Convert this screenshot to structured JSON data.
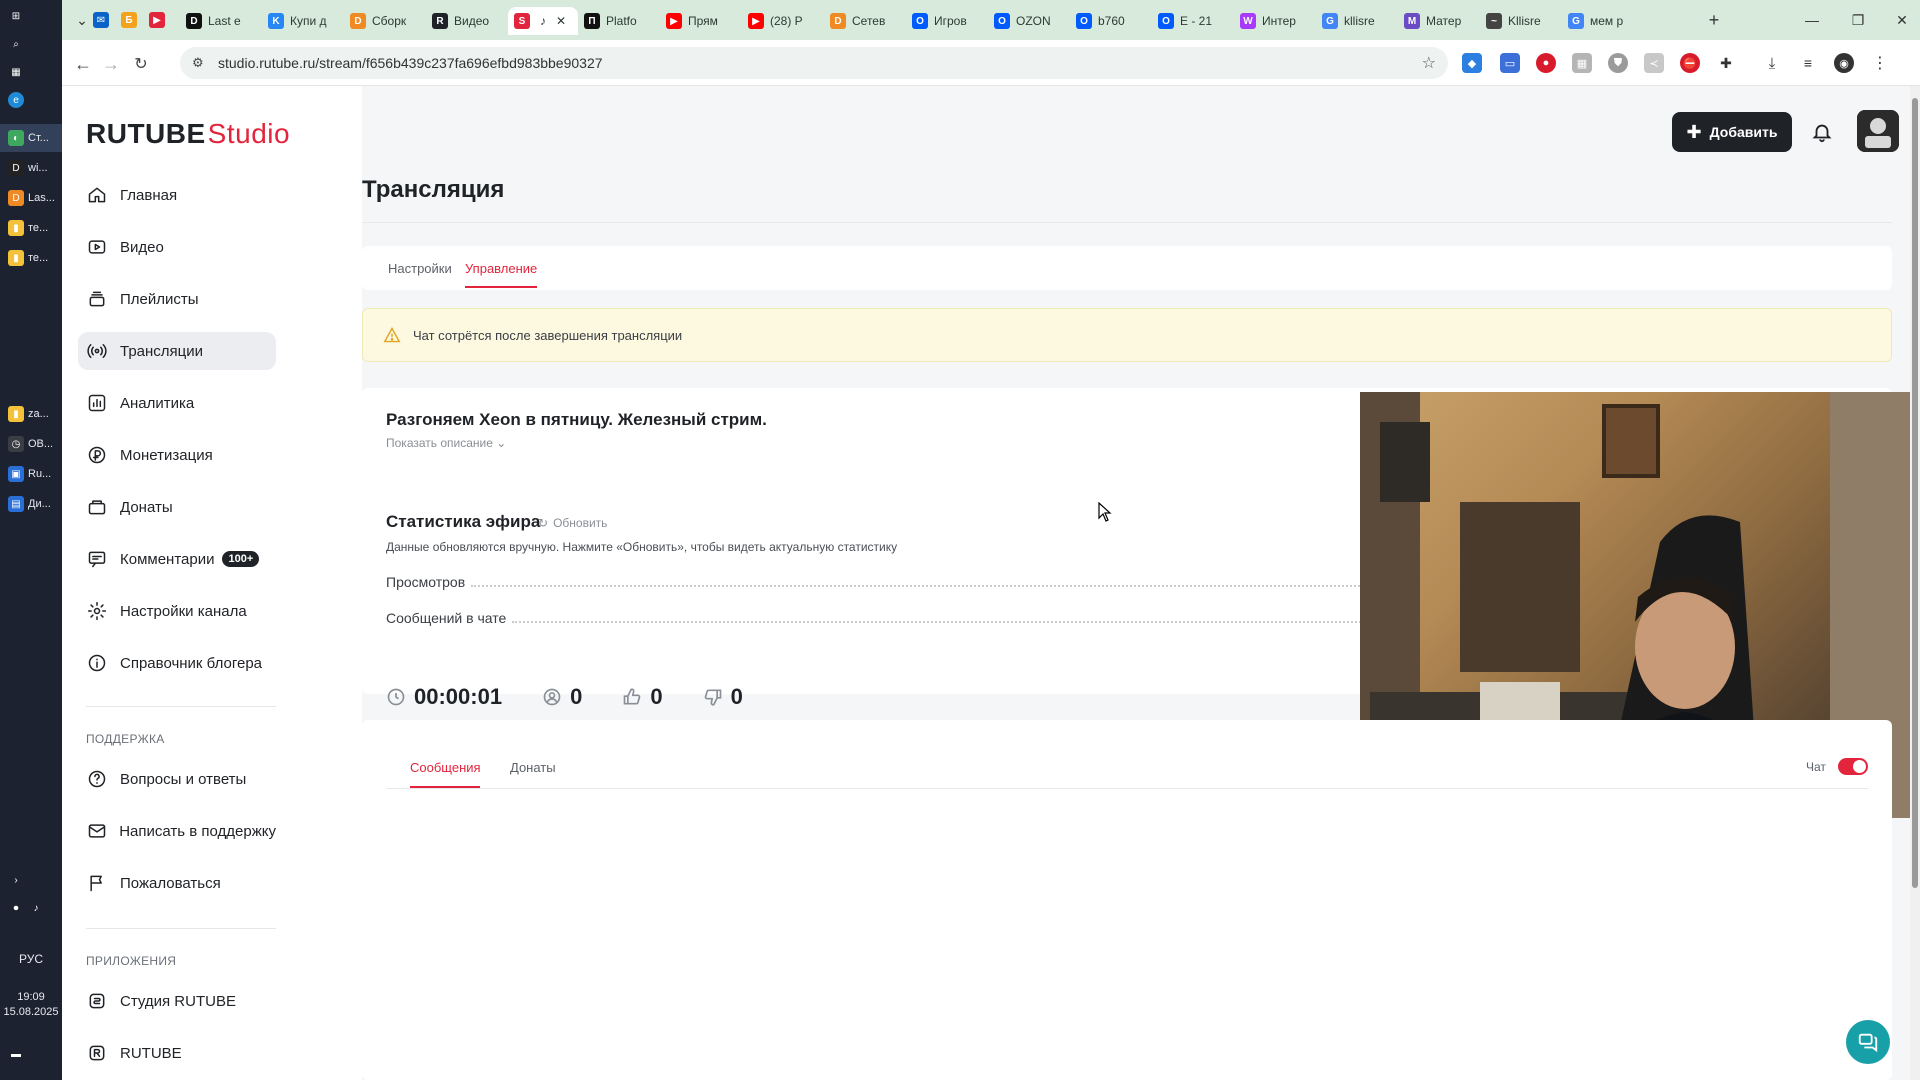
{
  "taskbar": {
    "items": [
      {
        "label": "Ст...",
        "color": "#3ea95e",
        "glyph": "◐"
      },
      {
        "label": "wi...",
        "color": "#222222",
        "glyph": "D"
      },
      {
        "label": "Las...",
        "color": "#f08a24",
        "glyph": "D"
      },
      {
        "label": "те...",
        "color": "#f3c13a",
        "glyph": "▮"
      },
      {
        "label": "те...",
        "color": "#f3c13a",
        "glyph": "▮"
      },
      {
        "label": "za...",
        "color": "#f3c13a",
        "glyph": "▮"
      },
      {
        "label": "ОВ...",
        "color": "#3a3e44",
        "glyph": "◷"
      },
      {
        "label": "Ru...",
        "color": "#2a6fd6",
        "glyph": "▣"
      },
      {
        "label": "Ди...",
        "color": "#2a6fd6",
        "glyph": "▤"
      }
    ],
    "lang": "РУС",
    "time": "19:09",
    "date": "15.08.2025"
  },
  "browser": {
    "tabs": [
      {
        "label": "Last e",
        "fav": "D",
        "color": "#111111"
      },
      {
        "label": "Купи д",
        "fav": "K",
        "color": "#2787f5"
      },
      {
        "label": "Сборк",
        "fav": "D",
        "color": "#f08a24"
      },
      {
        "label": "Видео",
        "fav": "R",
        "color": "#1f2226"
      },
      {
        "label": "",
        "fav": "S",
        "color": "#e2253c"
      },
      {
        "label": "Platfo",
        "fav": "П",
        "color": "#111111"
      },
      {
        "label": "Прям",
        "fav": "▶",
        "color": "#ff0000"
      },
      {
        "label": "(28) P",
        "fav": "▶",
        "color": "#ff0000"
      },
      {
        "label": "Сетев",
        "fav": "D",
        "color": "#f08a24"
      },
      {
        "label": "Игров",
        "fav": "O",
        "color": "#005bff"
      },
      {
        "label": "OZON",
        "fav": "O",
        "color": "#005bff"
      },
      {
        "label": "b760",
        "fav": "O",
        "color": "#005bff"
      },
      {
        "label": "E - 21",
        "fav": "O",
        "color": "#005bff"
      },
      {
        "label": "Интер",
        "fav": "W",
        "color": "#a73afd"
      },
      {
        "label": "kllisre",
        "fav": "G",
        "color": "#4285f4"
      },
      {
        "label": "Матер",
        "fav": "M",
        "color": "#6a4cc4"
      },
      {
        "label": "Kllisre",
        "fav": "~",
        "color": "#444444"
      },
      {
        "label": "мем р",
        "fav": "G",
        "color": "#4285f4"
      }
    ],
    "url": "studio.rutube.ru/stream/f656b439c237fa696efbd983bbe90327"
  },
  "logo": {
    "brand": "RUTUBE",
    "product": "Studio"
  },
  "sidebar": {
    "items": [
      {
        "label": "Главная",
        "icon": "home-icon"
      },
      {
        "label": "Видео",
        "icon": "video-icon"
      },
      {
        "label": "Плейлисты",
        "icon": "playlist-icon"
      },
      {
        "label": "Трансляции",
        "icon": "broadcast-icon"
      },
      {
        "label": "Аналитика",
        "icon": "analytics-icon"
      },
      {
        "label": "Монетизация",
        "icon": "monetization-icon"
      },
      {
        "label": "Донаты",
        "icon": "donate-icon"
      },
      {
        "label": "Комментарии",
        "icon": "comment-icon",
        "badge": "100+"
      },
      {
        "label": "Настройки канала",
        "icon": "gear-icon"
      },
      {
        "label": "Справочник блогера",
        "icon": "info-icon"
      }
    ],
    "support_title": "ПОДДЕРЖКА",
    "support": [
      {
        "label": "Вопросы и ответы",
        "icon": "question-icon"
      },
      {
        "label": "Написать в поддержку",
        "icon": "mail-icon"
      },
      {
        "label": "Пожаловаться",
        "icon": "flag-icon"
      }
    ],
    "apps_title": "ПРИЛОЖЕНИЯ",
    "apps": [
      {
        "label": "Студия RUTUBE",
        "icon": "studio-app-icon"
      },
      {
        "label": "RUTUBE",
        "icon": "rutube-app-icon"
      }
    ]
  },
  "header": {
    "add_label": "Добавить"
  },
  "page": {
    "title": "Трансляция",
    "tabs": [
      {
        "label": "Настройки"
      },
      {
        "label": "Управление"
      }
    ],
    "alert": "Чат сотрётся после завершения трансляции"
  },
  "stream": {
    "title": "Разгоняем Xeon в пятницу. Железный стрим.",
    "show_desc": "Показать описание",
    "stats_title": "Статистика эфира",
    "refresh_label": "Обновить",
    "stats_note": "Данные обновляются вручную. Нажмите «Обновить», чтобы видеть актуальную статистику",
    "rows": [
      {
        "label": "Просмотров"
      },
      {
        "label": "Сообщений в чате"
      }
    ],
    "duration": "00:00:01",
    "viewers": "0",
    "likes": "0",
    "dislikes": "0"
  },
  "chat": {
    "tabs": [
      {
        "label": "Сообщения"
      },
      {
        "label": "Донаты"
      }
    ],
    "toggle_label": "Чат"
  },
  "colors": {
    "accent": "#e2253c",
    "dark": "#1f2226",
    "help": "#18a0a8"
  }
}
